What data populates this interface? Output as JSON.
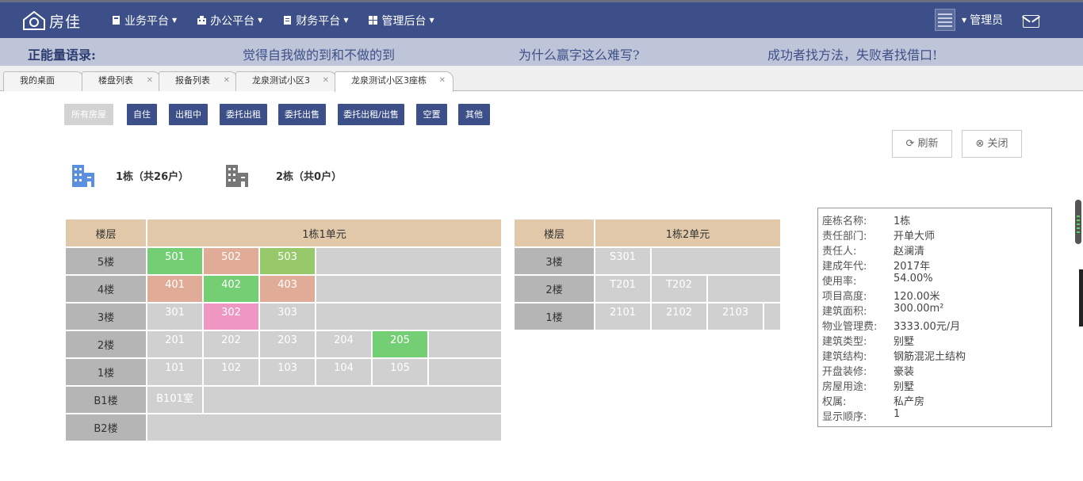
{
  "app": {
    "logo_text": "房佳",
    "user_name": "管理员"
  },
  "nav": {
    "menu": [
      {
        "label": "业务平台",
        "icon": "book-icon"
      },
      {
        "label": "办公平台",
        "icon": "building-icon"
      },
      {
        "label": "财务平台",
        "icon": "document-icon"
      },
      {
        "label": "管理后台",
        "icon": "grid-icon"
      }
    ]
  },
  "quotes": {
    "title": "正能量语录:",
    "items": [
      "觉得自我做的到和不做的到",
      "为什么赢字这么难写?",
      "成功者找方法，失败者找借口!"
    ]
  },
  "tabs": [
    {
      "label": "我的桌面",
      "active": false
    },
    {
      "label": "楼盘列表",
      "active": false
    },
    {
      "label": "报备列表",
      "active": false
    },
    {
      "label": "龙泉测试小区3",
      "active": false
    },
    {
      "label": "龙泉测试小区3座栋",
      "active": true
    }
  ],
  "filters": [
    "所有房屋",
    "自住",
    "出租中",
    "委托出租",
    "委托出售",
    "委托出租/出售",
    "空置",
    "其他"
  ],
  "actions": {
    "refresh": "刷新",
    "close": "关闭"
  },
  "buildings": [
    {
      "name": "1栋（共26户）"
    },
    {
      "name": "2栋（共0户）"
    }
  ],
  "unit1": {
    "floor_header": "楼层",
    "title": "1栋1单元",
    "rows": [
      {
        "floor": "5楼",
        "rooms": [
          {
            "no": "501",
            "status": "green"
          },
          {
            "no": "502",
            "status": "salmon"
          },
          {
            "no": "503",
            "status": "olive"
          }
        ]
      },
      {
        "floor": "4楼",
        "rooms": [
          {
            "no": "401",
            "status": "salmon"
          },
          {
            "no": "402",
            "status": "green"
          },
          {
            "no": "403",
            "status": "salmon"
          }
        ]
      },
      {
        "floor": "3楼",
        "rooms": [
          {
            "no": "301",
            "status": "gray"
          },
          {
            "no": "302",
            "status": "pink"
          },
          {
            "no": "303",
            "status": "gray"
          }
        ]
      },
      {
        "floor": "2楼",
        "rooms": [
          {
            "no": "201",
            "status": "gray"
          },
          {
            "no": "202",
            "status": "gray"
          },
          {
            "no": "203",
            "status": "gray"
          },
          {
            "no": "204",
            "status": "gray"
          },
          {
            "no": "205",
            "status": "green"
          }
        ]
      },
      {
        "floor": "1楼",
        "rooms": [
          {
            "no": "101",
            "status": "gray"
          },
          {
            "no": "102",
            "status": "gray"
          },
          {
            "no": "103",
            "status": "gray"
          },
          {
            "no": "104",
            "status": "gray"
          },
          {
            "no": "105",
            "status": "gray"
          }
        ]
      },
      {
        "floor": "B1楼",
        "rooms": [
          {
            "no": "B101室",
            "status": "gray"
          }
        ]
      },
      {
        "floor": "B2楼",
        "rooms": []
      }
    ]
  },
  "unit2": {
    "floor_header": "楼层",
    "title": "1栋2单元",
    "rows": [
      {
        "floor": "3楼",
        "rooms": [
          {
            "no": "S301",
            "status": "gray"
          }
        ]
      },
      {
        "floor": "2楼",
        "rooms": [
          {
            "no": "T201",
            "status": "gray"
          },
          {
            "no": "T202",
            "status": "gray"
          }
        ]
      },
      {
        "floor": "1楼",
        "rooms": [
          {
            "no": "2101",
            "status": "gray"
          },
          {
            "no": "2102",
            "status": "gray"
          },
          {
            "no": "2103",
            "status": "gray"
          }
        ]
      }
    ]
  },
  "info": [
    {
      "k": "座栋名称:",
      "v": "1栋"
    },
    {
      "k": "责任部门:",
      "v": "开单大师"
    },
    {
      "k": "责任人:",
      "v": "赵澜清"
    },
    {
      "k": "建成年代:",
      "v": "2017年"
    },
    {
      "k": "使用率:",
      "v": "54.00%"
    },
    {
      "k": "项目高度:",
      "v": "120.00米"
    },
    {
      "k": "建筑面积:",
      "v": "300.00m²"
    },
    {
      "k": "物业管理费:",
      "v": "3333.00元/月"
    },
    {
      "k": "建筑类型:",
      "v": "别墅"
    },
    {
      "k": "建筑结构:",
      "v": "钢筋混泥土结构"
    },
    {
      "k": "开盘装修:",
      "v": "豪装"
    },
    {
      "k": "房屋用途:",
      "v": "别墅"
    },
    {
      "k": "权属:",
      "v": "私产房"
    },
    {
      "k": "显示顺序:",
      "v": "1"
    }
  ],
  "colors": {
    "nav": "#3d4f88",
    "quote_bg": "#bfc5d9",
    "header": "#e0c8a8",
    "floor": "#b5b5b5",
    "green": "#74cf74",
    "salmon": "#e0ab97",
    "pink": "#ee97c3",
    "olive": "#97c86a",
    "gray": "#d0d0d0"
  }
}
